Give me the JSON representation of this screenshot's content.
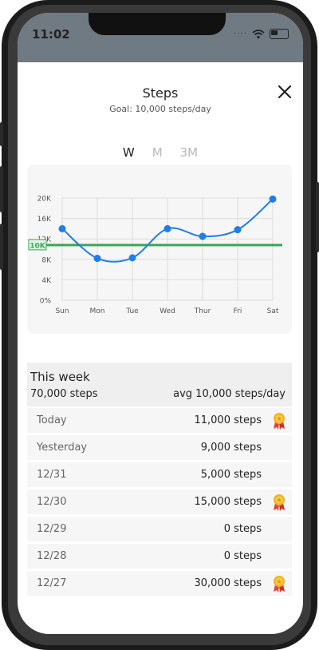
{
  "status_bar": {
    "time": "11:02",
    "signal": "····"
  },
  "header": {
    "title": "Steps",
    "goal": "Goal: 10,000 steps/day"
  },
  "tabs": [
    {
      "label": "W",
      "active": true
    },
    {
      "label": "M",
      "active": false
    },
    {
      "label": "3M",
      "active": false
    }
  ],
  "chart_data": {
    "type": "line",
    "categories": [
      "Sun",
      "Mon",
      "Tue",
      "Wed",
      "Thur",
      "Fri",
      "Sat"
    ],
    "y_tick_labels": [
      "0%",
      "4K",
      "8K",
      "12K",
      "16K",
      "20K"
    ],
    "ylim": [
      0,
      20000
    ],
    "goal_line": {
      "value": 10800,
      "label": "10K",
      "color": "#3aa757"
    },
    "series": [
      {
        "values": [
          14000,
          8200,
          8300,
          14000,
          12500,
          13800,
          19800
        ],
        "color": "#1f7ee8"
      }
    ]
  },
  "summary": {
    "label": "This week",
    "total": "70,000 steps",
    "average": "avg 10,000 steps/day"
  },
  "days": [
    {
      "day": "Today",
      "steps": "11,000 steps",
      "award": true
    },
    {
      "day": "Yesterday",
      "steps": "9,000 steps",
      "award": false
    },
    {
      "day": "12/31",
      "steps": "5,000 steps",
      "award": false
    },
    {
      "day": "12/30",
      "steps": "15,000 steps",
      "award": true
    },
    {
      "day": "12/29",
      "steps": "0 steps",
      "award": false
    },
    {
      "day": "12/28",
      "steps": "0 steps",
      "award": false
    },
    {
      "day": "12/27",
      "steps": "30,000 steps",
      "award": true
    }
  ]
}
